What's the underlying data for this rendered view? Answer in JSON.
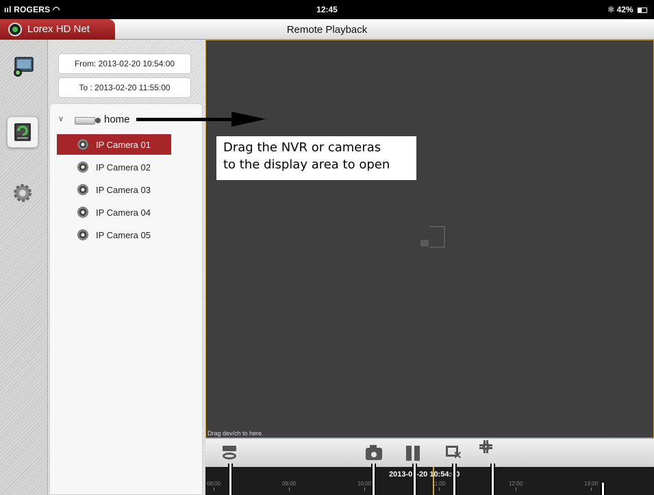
{
  "status_bar": {
    "carrier": "ııl ROGERS",
    "wifi_icon": "wifi-icon",
    "time": "12:45",
    "battery": "42%"
  },
  "title_bar": {
    "app_name": "Lorex HD Net",
    "screen_title": "Remote Playback"
  },
  "rail": {
    "items": [
      {
        "name": "live-view",
        "icon": "live-view-icon",
        "active": false
      },
      {
        "name": "remote-playback",
        "icon": "playback-icon",
        "active": true
      },
      {
        "name": "settings",
        "icon": "gear-icon",
        "active": false
      }
    ]
  },
  "panel": {
    "from_label": "From: 2013-02-20 10:54:00",
    "to_label": "To  : 2013-02-20 11:55:00",
    "device": {
      "name": "home",
      "expanded": true,
      "cameras": [
        {
          "label": "IP Camera 01",
          "selected": true
        },
        {
          "label": "IP Camera 02",
          "selected": false
        },
        {
          "label": "IP Camera 03",
          "selected": false
        },
        {
          "label": "IP Camera 04",
          "selected": false
        },
        {
          "label": "IP Camera 05",
          "selected": false
        }
      ]
    }
  },
  "display": {
    "drag_hint": "Drag dev/ch to here."
  },
  "annotation": {
    "line1": "Drag the NVR or cameras",
    "line2": "to the display area to open"
  },
  "toolbar": {
    "buttons": [
      "record-icon",
      "snapshot-icon",
      "pause-icon",
      "close-channel-icon",
      "fullscreen-icon"
    ]
  },
  "timeline": {
    "current_time": "2013-02-20 10:54:00",
    "ticks": [
      "08:00",
      "09:00",
      "10:00",
      "11:00",
      "12:00",
      "13:00"
    ]
  },
  "colors": {
    "brand_red": "#a52528",
    "display_bg": "#3f3f3f",
    "display_border": "#c59a3a",
    "timeline_cursor": "#d7a924"
  }
}
